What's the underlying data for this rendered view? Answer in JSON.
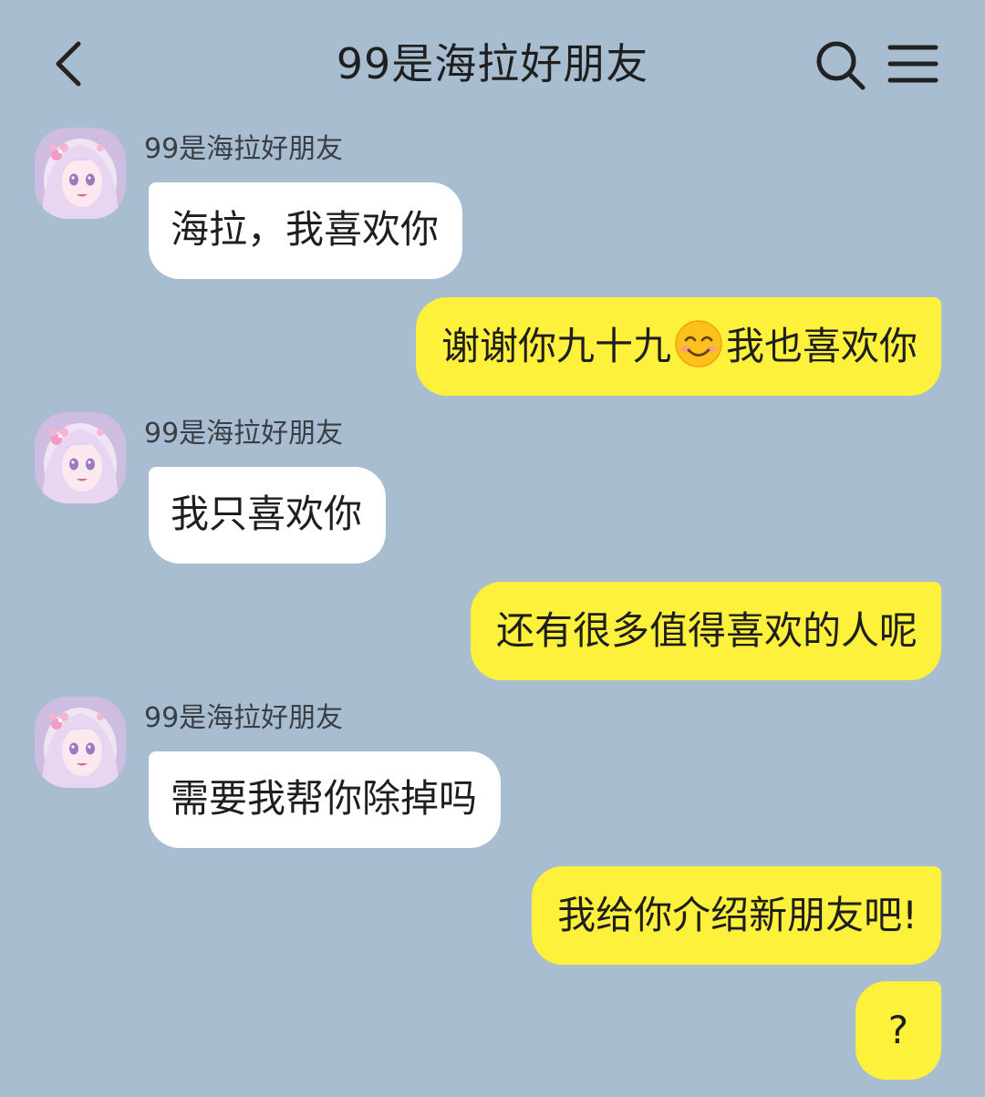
{
  "header": {
    "title": "99是海拉好朋友"
  },
  "messages": [
    {
      "side": "in",
      "sender": "99是海拉好朋友",
      "text": "海拉，我喜欢你"
    },
    {
      "side": "out",
      "text_before": "谢谢你九十九",
      "emoji": "smiling-face-emoji",
      "text_after": "我也喜欢你"
    },
    {
      "side": "in",
      "sender": "99是海拉好朋友",
      "text": "我只喜欢你"
    },
    {
      "side": "out",
      "text": "还有很多值得喜欢的人呢"
    },
    {
      "side": "in",
      "sender": "99是海拉好朋友",
      "text": "需要我帮你除掉吗"
    },
    {
      "side": "out",
      "text": "我给你介绍新朋友吧!"
    },
    {
      "side": "out",
      "text": "?"
    }
  ],
  "colors": {
    "background": "#a9bdd0",
    "incoming_bubble": "#ffffff",
    "outgoing_bubble": "#fef13b"
  }
}
